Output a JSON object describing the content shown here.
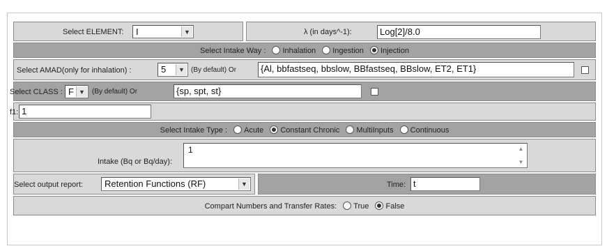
{
  "row1": {
    "element_label": "Select ELEMENT:",
    "element_value": "I",
    "lambda_label": "λ (in days^-1):",
    "lambda_value": "Log[2]/8.0"
  },
  "row2": {
    "label": "Select Intake Way :",
    "options": [
      "Inhalation",
      "Ingestion",
      "Injection"
    ],
    "selected": "Injection"
  },
  "row3": {
    "label": "Select AMAD(only for inhalation) :",
    "amad_value": "5",
    "by_default": "(By default) Or",
    "compartments": "{Al, bbfastseq, bbslow,  BBfastseq, BBslow, ET2, ET1}",
    "checked": false
  },
  "row4": {
    "label": "Select CLASS :",
    "class_value": "F",
    "by_default": "(By default) Or",
    "class_list": "{sp, spt, st}",
    "checked": false
  },
  "row5": {
    "label": "f1:",
    "f1_value": "1"
  },
  "row6": {
    "label": "Select Intake Type :",
    "options": [
      "Acute",
      "Constant Chronic",
      "MultiInputs",
      "Continuous"
    ],
    "selected": "Constant Chronic"
  },
  "row7": {
    "label": "Intake (Bq or Bq/day):",
    "value": "1"
  },
  "row8": {
    "output_label": "Select output report:",
    "output_value": "Retention Functions (RF)",
    "time_label": "Time:",
    "time_value": "t"
  },
  "row9": {
    "label": "Compart Numbers and Transfer Rates:",
    "options": [
      "True",
      "False"
    ],
    "selected": "False"
  }
}
